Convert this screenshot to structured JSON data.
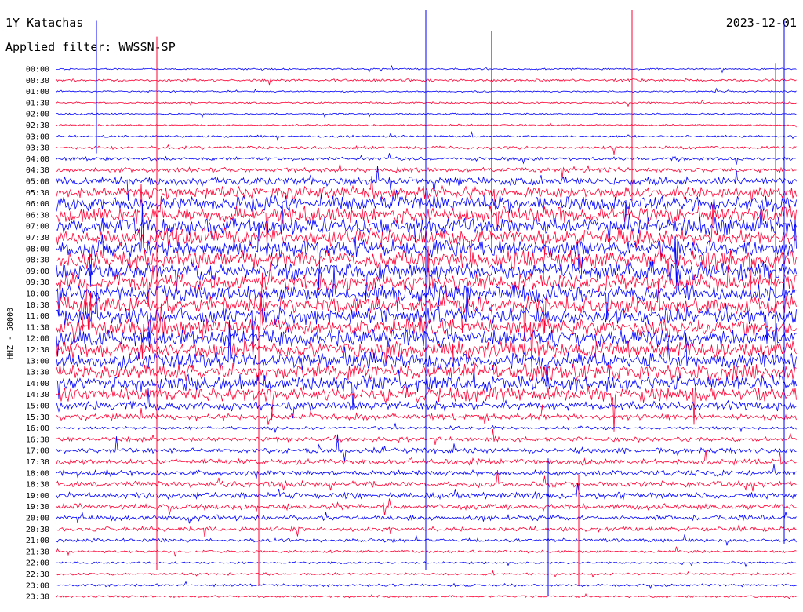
{
  "chart_data": {
    "type": "line",
    "station": "1Y Katachas",
    "date": "2023-12-01",
    "filter_label": "Applied filter: WWSSN-SP",
    "ylabel": "HHZ - 50000",
    "colors": [
      "#0000ff",
      "#ff0033"
    ],
    "tick_labels": [
      "00:00",
      "00:30",
      "01:00",
      "01:30",
      "02:00",
      "02:30",
      "03:00",
      "03:30",
      "04:00",
      "04:30",
      "05:00",
      "05:30",
      "06:00",
      "06:30",
      "07:00",
      "07:30",
      "08:00",
      "08:30",
      "09:00",
      "09:30",
      "10:00",
      "10:30",
      "11:00",
      "11:30",
      "12:00",
      "12:30",
      "13:00",
      "13:30",
      "14:00",
      "14:30",
      "15:00",
      "15:30",
      "16:00",
      "16:30",
      "17:00",
      "17:30",
      "18:00",
      "18:30",
      "19:00",
      "19:30",
      "20:00",
      "20:30",
      "21:00",
      "21:30",
      "22:00",
      "22:30",
      "23:00",
      "23:30"
    ],
    "relative_amplitude": [
      0.3,
      0.5,
      0.3,
      0.35,
      0.3,
      0.35,
      0.4,
      0.6,
      0.7,
      0.9,
      1.6,
      2.4,
      3.0,
      3.2,
      3.3,
      3.4,
      3.4,
      3.4,
      3.4,
      3.3,
      3.3,
      3.3,
      3.3,
      3.3,
      3.3,
      3.2,
      3.2,
      3.1,
      3.0,
      2.8,
      1.8,
      1.2,
      0.6,
      0.9,
      1.0,
      1.1,
      1.1,
      1.1,
      1.2,
      1.1,
      1.0,
      0.9,
      0.7,
      0.5,
      0.4,
      0.45,
      0.5,
      0.4
    ]
  }
}
